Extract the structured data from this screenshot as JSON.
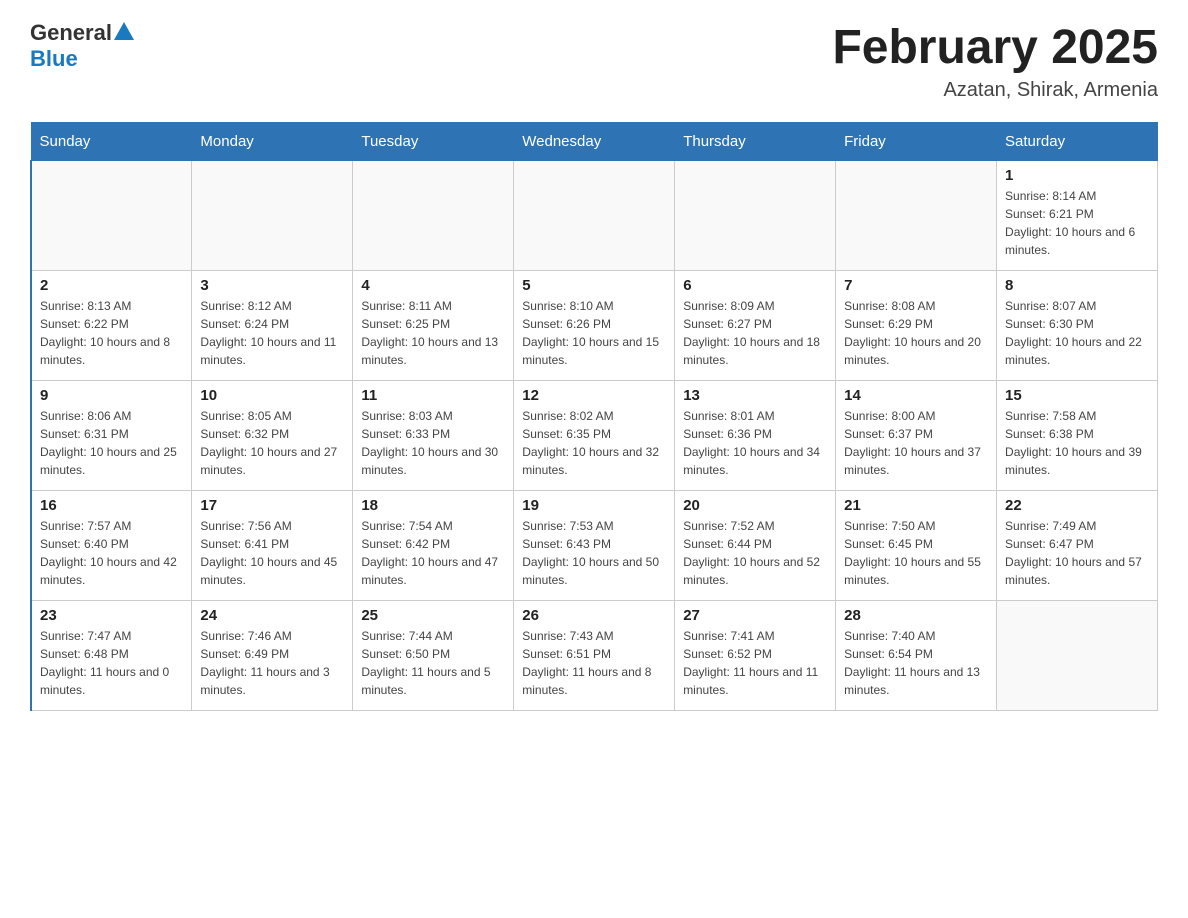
{
  "header": {
    "logo_general": "General",
    "logo_blue": "Blue",
    "month_title": "February 2025",
    "location": "Azatan, Shirak, Armenia"
  },
  "weekdays": [
    "Sunday",
    "Monday",
    "Tuesday",
    "Wednesday",
    "Thursday",
    "Friday",
    "Saturday"
  ],
  "weeks": [
    [
      {
        "day": "",
        "info": ""
      },
      {
        "day": "",
        "info": ""
      },
      {
        "day": "",
        "info": ""
      },
      {
        "day": "",
        "info": ""
      },
      {
        "day": "",
        "info": ""
      },
      {
        "day": "",
        "info": ""
      },
      {
        "day": "1",
        "info": "Sunrise: 8:14 AM\nSunset: 6:21 PM\nDaylight: 10 hours and 6 minutes."
      }
    ],
    [
      {
        "day": "2",
        "info": "Sunrise: 8:13 AM\nSunset: 6:22 PM\nDaylight: 10 hours and 8 minutes."
      },
      {
        "day": "3",
        "info": "Sunrise: 8:12 AM\nSunset: 6:24 PM\nDaylight: 10 hours and 11 minutes."
      },
      {
        "day": "4",
        "info": "Sunrise: 8:11 AM\nSunset: 6:25 PM\nDaylight: 10 hours and 13 minutes."
      },
      {
        "day": "5",
        "info": "Sunrise: 8:10 AM\nSunset: 6:26 PM\nDaylight: 10 hours and 15 minutes."
      },
      {
        "day": "6",
        "info": "Sunrise: 8:09 AM\nSunset: 6:27 PM\nDaylight: 10 hours and 18 minutes."
      },
      {
        "day": "7",
        "info": "Sunrise: 8:08 AM\nSunset: 6:29 PM\nDaylight: 10 hours and 20 minutes."
      },
      {
        "day": "8",
        "info": "Sunrise: 8:07 AM\nSunset: 6:30 PM\nDaylight: 10 hours and 22 minutes."
      }
    ],
    [
      {
        "day": "9",
        "info": "Sunrise: 8:06 AM\nSunset: 6:31 PM\nDaylight: 10 hours and 25 minutes."
      },
      {
        "day": "10",
        "info": "Sunrise: 8:05 AM\nSunset: 6:32 PM\nDaylight: 10 hours and 27 minutes."
      },
      {
        "day": "11",
        "info": "Sunrise: 8:03 AM\nSunset: 6:33 PM\nDaylight: 10 hours and 30 minutes."
      },
      {
        "day": "12",
        "info": "Sunrise: 8:02 AM\nSunset: 6:35 PM\nDaylight: 10 hours and 32 minutes."
      },
      {
        "day": "13",
        "info": "Sunrise: 8:01 AM\nSunset: 6:36 PM\nDaylight: 10 hours and 34 minutes."
      },
      {
        "day": "14",
        "info": "Sunrise: 8:00 AM\nSunset: 6:37 PM\nDaylight: 10 hours and 37 minutes."
      },
      {
        "day": "15",
        "info": "Sunrise: 7:58 AM\nSunset: 6:38 PM\nDaylight: 10 hours and 39 minutes."
      }
    ],
    [
      {
        "day": "16",
        "info": "Sunrise: 7:57 AM\nSunset: 6:40 PM\nDaylight: 10 hours and 42 minutes."
      },
      {
        "day": "17",
        "info": "Sunrise: 7:56 AM\nSunset: 6:41 PM\nDaylight: 10 hours and 45 minutes."
      },
      {
        "day": "18",
        "info": "Sunrise: 7:54 AM\nSunset: 6:42 PM\nDaylight: 10 hours and 47 minutes."
      },
      {
        "day": "19",
        "info": "Sunrise: 7:53 AM\nSunset: 6:43 PM\nDaylight: 10 hours and 50 minutes."
      },
      {
        "day": "20",
        "info": "Sunrise: 7:52 AM\nSunset: 6:44 PM\nDaylight: 10 hours and 52 minutes."
      },
      {
        "day": "21",
        "info": "Sunrise: 7:50 AM\nSunset: 6:45 PM\nDaylight: 10 hours and 55 minutes."
      },
      {
        "day": "22",
        "info": "Sunrise: 7:49 AM\nSunset: 6:47 PM\nDaylight: 10 hours and 57 minutes."
      }
    ],
    [
      {
        "day": "23",
        "info": "Sunrise: 7:47 AM\nSunset: 6:48 PM\nDaylight: 11 hours and 0 minutes."
      },
      {
        "day": "24",
        "info": "Sunrise: 7:46 AM\nSunset: 6:49 PM\nDaylight: 11 hours and 3 minutes."
      },
      {
        "day": "25",
        "info": "Sunrise: 7:44 AM\nSunset: 6:50 PM\nDaylight: 11 hours and 5 minutes."
      },
      {
        "day": "26",
        "info": "Sunrise: 7:43 AM\nSunset: 6:51 PM\nDaylight: 11 hours and 8 minutes."
      },
      {
        "day": "27",
        "info": "Sunrise: 7:41 AM\nSunset: 6:52 PM\nDaylight: 11 hours and 11 minutes."
      },
      {
        "day": "28",
        "info": "Sunrise: 7:40 AM\nSunset: 6:54 PM\nDaylight: 11 hours and 13 minutes."
      },
      {
        "day": "",
        "info": ""
      }
    ]
  ]
}
